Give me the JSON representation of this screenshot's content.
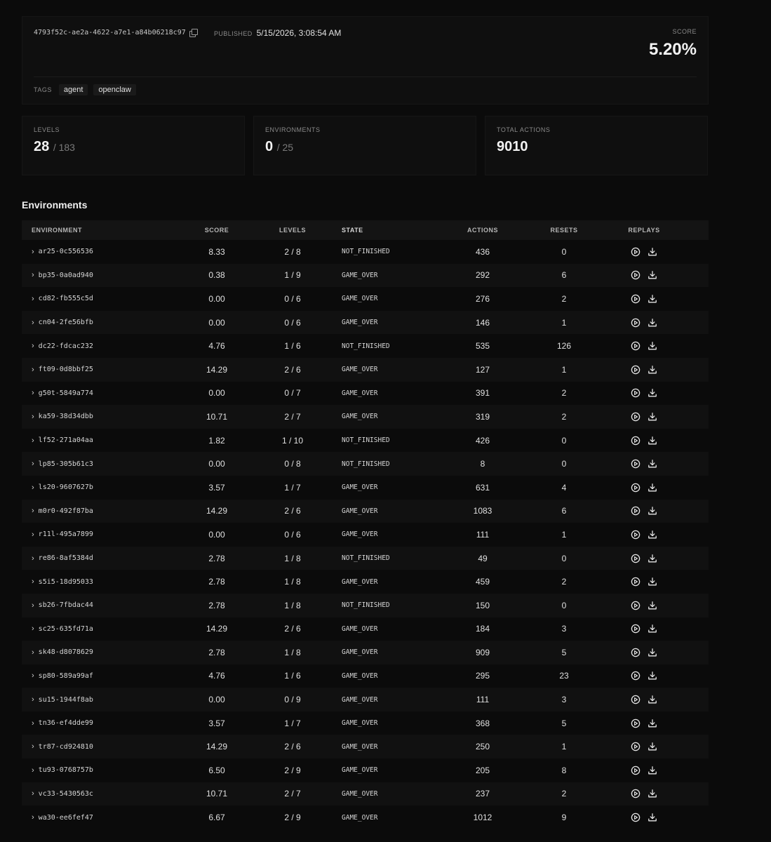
{
  "header": {
    "run_id": "4793f52c-ae2a-4622-a7e1-a84b06218c97",
    "published_label": "PUBLISHED",
    "published_value": "5/15/2026, 3:08:54 AM",
    "score_label": "SCORE",
    "score_value": "5.20%",
    "tags_label": "TAGS",
    "tags": [
      "agent",
      "openclaw"
    ]
  },
  "stats": {
    "levels": {
      "label": "LEVELS",
      "value": "28",
      "total": "/ 183"
    },
    "environments": {
      "label": "ENVIRONMENTS",
      "value": "0",
      "total": "/ 25"
    },
    "total_actions": {
      "label": "TOTAL ACTIONS",
      "value": "9010"
    }
  },
  "section_title": "Environments",
  "table": {
    "headers": {
      "environment": "ENVIRONMENT",
      "score": "SCORE",
      "levels": "LEVELS",
      "state": "STATE",
      "actions": "ACTIONS",
      "resets": "RESETS",
      "replays": "REPLAYS"
    },
    "rows": [
      {
        "environment": "ar25-0c556536",
        "score": "8.33",
        "levels": "2 / 8",
        "state": "NOT_FINISHED",
        "actions": "436",
        "resets": "0"
      },
      {
        "environment": "bp35-0a0ad940",
        "score": "0.38",
        "levels": "1 / 9",
        "state": "GAME_OVER",
        "actions": "292",
        "resets": "6"
      },
      {
        "environment": "cd82-fb555c5d",
        "score": "0.00",
        "levels": "0 / 6",
        "state": "GAME_OVER",
        "actions": "276",
        "resets": "2"
      },
      {
        "environment": "cn04-2fe56bfb",
        "score": "0.00",
        "levels": "0 / 6",
        "state": "GAME_OVER",
        "actions": "146",
        "resets": "1"
      },
      {
        "environment": "dc22-fdcac232",
        "score": "4.76",
        "levels": "1 / 6",
        "state": "NOT_FINISHED",
        "actions": "535",
        "resets": "126"
      },
      {
        "environment": "ft09-0d8bbf25",
        "score": "14.29",
        "levels": "2 / 6",
        "state": "GAME_OVER",
        "actions": "127",
        "resets": "1"
      },
      {
        "environment": "g50t-5849a774",
        "score": "0.00",
        "levels": "0 / 7",
        "state": "GAME_OVER",
        "actions": "391",
        "resets": "2"
      },
      {
        "environment": "ka59-38d34dbb",
        "score": "10.71",
        "levels": "2 / 7",
        "state": "GAME_OVER",
        "actions": "319",
        "resets": "2"
      },
      {
        "environment": "lf52-271a04aa",
        "score": "1.82",
        "levels": "1 / 10",
        "state": "NOT_FINISHED",
        "actions": "426",
        "resets": "0"
      },
      {
        "environment": "lp85-305b61c3",
        "score": "0.00",
        "levels": "0 / 8",
        "state": "NOT_FINISHED",
        "actions": "8",
        "resets": "0"
      },
      {
        "environment": "ls20-9607627b",
        "score": "3.57",
        "levels": "1 / 7",
        "state": "GAME_OVER",
        "actions": "631",
        "resets": "4"
      },
      {
        "environment": "m0r0-492f87ba",
        "score": "14.29",
        "levels": "2 / 6",
        "state": "GAME_OVER",
        "actions": "1083",
        "resets": "6"
      },
      {
        "environment": "r11l-495a7899",
        "score": "0.00",
        "levels": "0 / 6",
        "state": "GAME_OVER",
        "actions": "111",
        "resets": "1"
      },
      {
        "environment": "re86-8af5384d",
        "score": "2.78",
        "levels": "1 / 8",
        "state": "NOT_FINISHED",
        "actions": "49",
        "resets": "0"
      },
      {
        "environment": "s5i5-18d95033",
        "score": "2.78",
        "levels": "1 / 8",
        "state": "GAME_OVER",
        "actions": "459",
        "resets": "2"
      },
      {
        "environment": "sb26-7fbdac44",
        "score": "2.78",
        "levels": "1 / 8",
        "state": "NOT_FINISHED",
        "actions": "150",
        "resets": "0"
      },
      {
        "environment": "sc25-635fd71a",
        "score": "14.29",
        "levels": "2 / 6",
        "state": "GAME_OVER",
        "actions": "184",
        "resets": "3"
      },
      {
        "environment": "sk48-d8078629",
        "score": "2.78",
        "levels": "1 / 8",
        "state": "GAME_OVER",
        "actions": "909",
        "resets": "5"
      },
      {
        "environment": "sp80-589a99af",
        "score": "4.76",
        "levels": "1 / 6",
        "state": "GAME_OVER",
        "actions": "295",
        "resets": "23"
      },
      {
        "environment": "su15-1944f8ab",
        "score": "0.00",
        "levels": "0 / 9",
        "state": "GAME_OVER",
        "actions": "111",
        "resets": "3"
      },
      {
        "environment": "tn36-ef4dde99",
        "score": "3.57",
        "levels": "1 / 7",
        "state": "GAME_OVER",
        "actions": "368",
        "resets": "5"
      },
      {
        "environment": "tr87-cd924810",
        "score": "14.29",
        "levels": "2 / 6",
        "state": "GAME_OVER",
        "actions": "250",
        "resets": "1"
      },
      {
        "environment": "tu93-0768757b",
        "score": "6.50",
        "levels": "2 / 9",
        "state": "GAME_OVER",
        "actions": "205",
        "resets": "8"
      },
      {
        "environment": "vc33-5430563c",
        "score": "10.71",
        "levels": "2 / 7",
        "state": "GAME_OVER",
        "actions": "237",
        "resets": "2"
      },
      {
        "environment": "wa30-ee6fef47",
        "score": "6.67",
        "levels": "2 / 9",
        "state": "GAME_OVER",
        "actions": "1012",
        "resets": "9"
      }
    ],
    "row_icons": {
      "expand": "chevron-right-icon",
      "replay": "play-circle-icon",
      "download": "download-icon"
    }
  }
}
